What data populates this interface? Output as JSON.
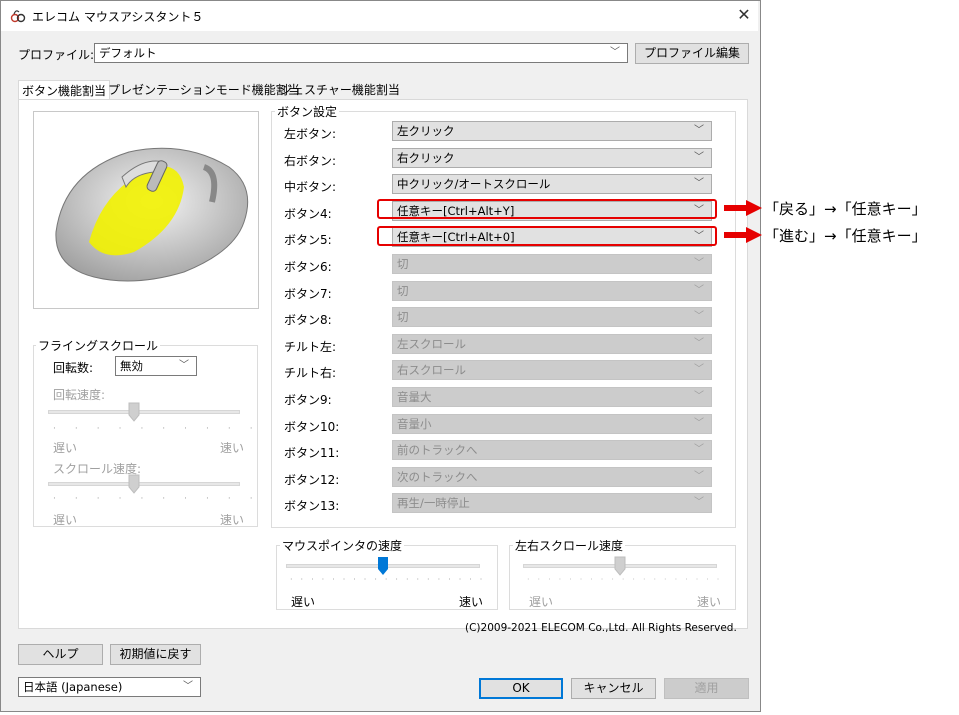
{
  "window": {
    "title": "エレコム マウスアシスタント５",
    "close_label": "✕"
  },
  "profile": {
    "label": "プロファイル:",
    "value": "デフォルト",
    "edit_button": "プロファイル編集"
  },
  "tabs": [
    {
      "label": "ボタン機能割当",
      "active": true
    },
    {
      "label": "プレゼンテーションモード機能割当",
      "active": false
    },
    {
      "label": "ジェスチャー機能割当",
      "active": false
    }
  ],
  "button_settings": {
    "group_title": "ボタン設定",
    "rows": [
      {
        "label": "左ボタン:",
        "value": "左クリック",
        "enabled": true
      },
      {
        "label": "右ボタン:",
        "value": "右クリック",
        "enabled": true
      },
      {
        "label": "中ボタン:",
        "value": "中クリック/オートスクロール",
        "enabled": true
      },
      {
        "label": "ボタン4:",
        "value": "任意キー[Ctrl+Alt+Y]",
        "enabled": true,
        "highlighted": true
      },
      {
        "label": "ボタン5:",
        "value": "任意キー[Ctrl+Alt+0]",
        "enabled": true,
        "highlighted": true
      },
      {
        "label": "ボタン6:",
        "value": "切",
        "enabled": false
      },
      {
        "label": "ボタン7:",
        "value": "切",
        "enabled": false
      },
      {
        "label": "ボタン8:",
        "value": "切",
        "enabled": false
      },
      {
        "label": "チルト左:",
        "value": "左スクロール",
        "enabled": false
      },
      {
        "label": "チルト右:",
        "value": "右スクロール",
        "enabled": false
      },
      {
        "label": "ボタン9:",
        "value": "音量大",
        "enabled": false
      },
      {
        "label": "ボタン10:",
        "value": "音量小",
        "enabled": false
      },
      {
        "label": "ボタン11:",
        "value": "前のトラックへ",
        "enabled": false
      },
      {
        "label": "ボタン12:",
        "value": "次のトラックへ",
        "enabled": false
      },
      {
        "label": "ボタン13:",
        "value": "再生/一時停止",
        "enabled": false
      }
    ]
  },
  "flying_scroll": {
    "group_title": "フライングスクロール",
    "rotations_label": "回転数:",
    "rotations_value": "無効",
    "speed_label": "回転速度:",
    "speed_slow": "遅い",
    "speed_fast": "速い",
    "scroll_speed_label": "スクロール速度:",
    "scroll_slow": "遅い",
    "scroll_fast": "速い"
  },
  "pointer_speed": {
    "group_title": "マウスポインタの速度",
    "slow": "遅い",
    "fast": "速い",
    "level": 0.5
  },
  "hscroll_speed": {
    "group_title": "左右スクロール速度",
    "slow": "遅い",
    "fast": "速い",
    "level": 0.5
  },
  "copyright": "(C)2009-2021 ELECOM Co.,Ltd. All Rights Reserved.",
  "footer": {
    "help_button": "ヘルプ",
    "reset_button": "初期値に戻す",
    "language": "日本語 (Japanese)",
    "ok_button": "OK",
    "cancel_button": "キャンセル",
    "apply_button": "適用"
  },
  "annotations": [
    {
      "text": "「戻る」→「任意キー」"
    },
    {
      "text": "「進む」→「任意キー」"
    }
  ],
  "colors": {
    "highlight_red": "#e60000",
    "mouse_highlight": "#f2f200",
    "slider_accent": "#0078d7"
  }
}
